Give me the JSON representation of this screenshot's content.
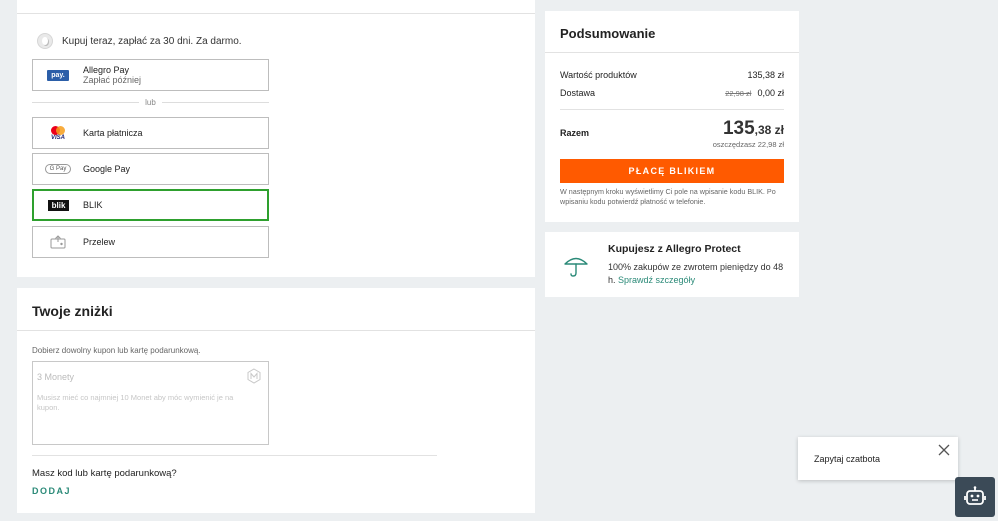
{
  "payments": {
    "bnpl_text": "Kupuj teraz, zapłać za 30 dni. Za darmo.",
    "allegro_pay": {
      "icon": "allegro-pay-icon",
      "icon_text": "pay.",
      "label": "Allegro Pay",
      "sublabel": "Zapłać później"
    },
    "or_label": "lub",
    "card": {
      "icon": "mastercard-visa-icon",
      "visa_text": "VISA",
      "label": "Karta płatnicza"
    },
    "gpay": {
      "icon": "google-pay-icon",
      "icon_text": "G Pay",
      "label": "Google Pay"
    },
    "blik": {
      "icon": "blik-icon",
      "icon_text": "blik",
      "label": "BLIK",
      "selected": true
    },
    "transfer": {
      "icon": "bank-transfer-icon",
      "label": "Przelew"
    }
  },
  "discounts": {
    "title": "Twoje zniżki",
    "label": "Dobierz dowolny kupon lub kartę podarunkową.",
    "coupon_title": "3 Monety",
    "coupon_desc": "Musisz mieć co najmniej 10 Monet aby móc wymienić je na kupon.",
    "question": "Masz kod lub kartę podarunkową?",
    "add_button": "DODAJ"
  },
  "summary": {
    "title": "Podsumowanie",
    "products_label": "Wartość produktów",
    "products_value": "135,38 zł",
    "delivery_label": "Dostawa",
    "delivery_old": "22,98 zł",
    "delivery_value": "0,00 zł",
    "total_label": "Razem",
    "total_int": "135",
    "total_frac": ",38 zł",
    "savings": "oszczędzasz 22,98 zł",
    "pay_button": "PŁACĘ BLIKIEM",
    "note": "W następnym kroku wyświetlimy Ci pole na wpisanie kodu BLIK. Po wpisaniu kodu potwierdź płatność w telefonie."
  },
  "protect": {
    "title": "Kupujesz z Allegro Protect",
    "text": "100% zakupów ze zwrotem pieniędzy do 48 h.",
    "link": "Sprawdź szczegóły"
  },
  "chat": {
    "label": "Zapytaj czatbota"
  },
  "colors": {
    "accent": "#ff5a00",
    "link": "#2b8a78",
    "selected_border": "#2ea02e",
    "background": "#eceff1"
  }
}
